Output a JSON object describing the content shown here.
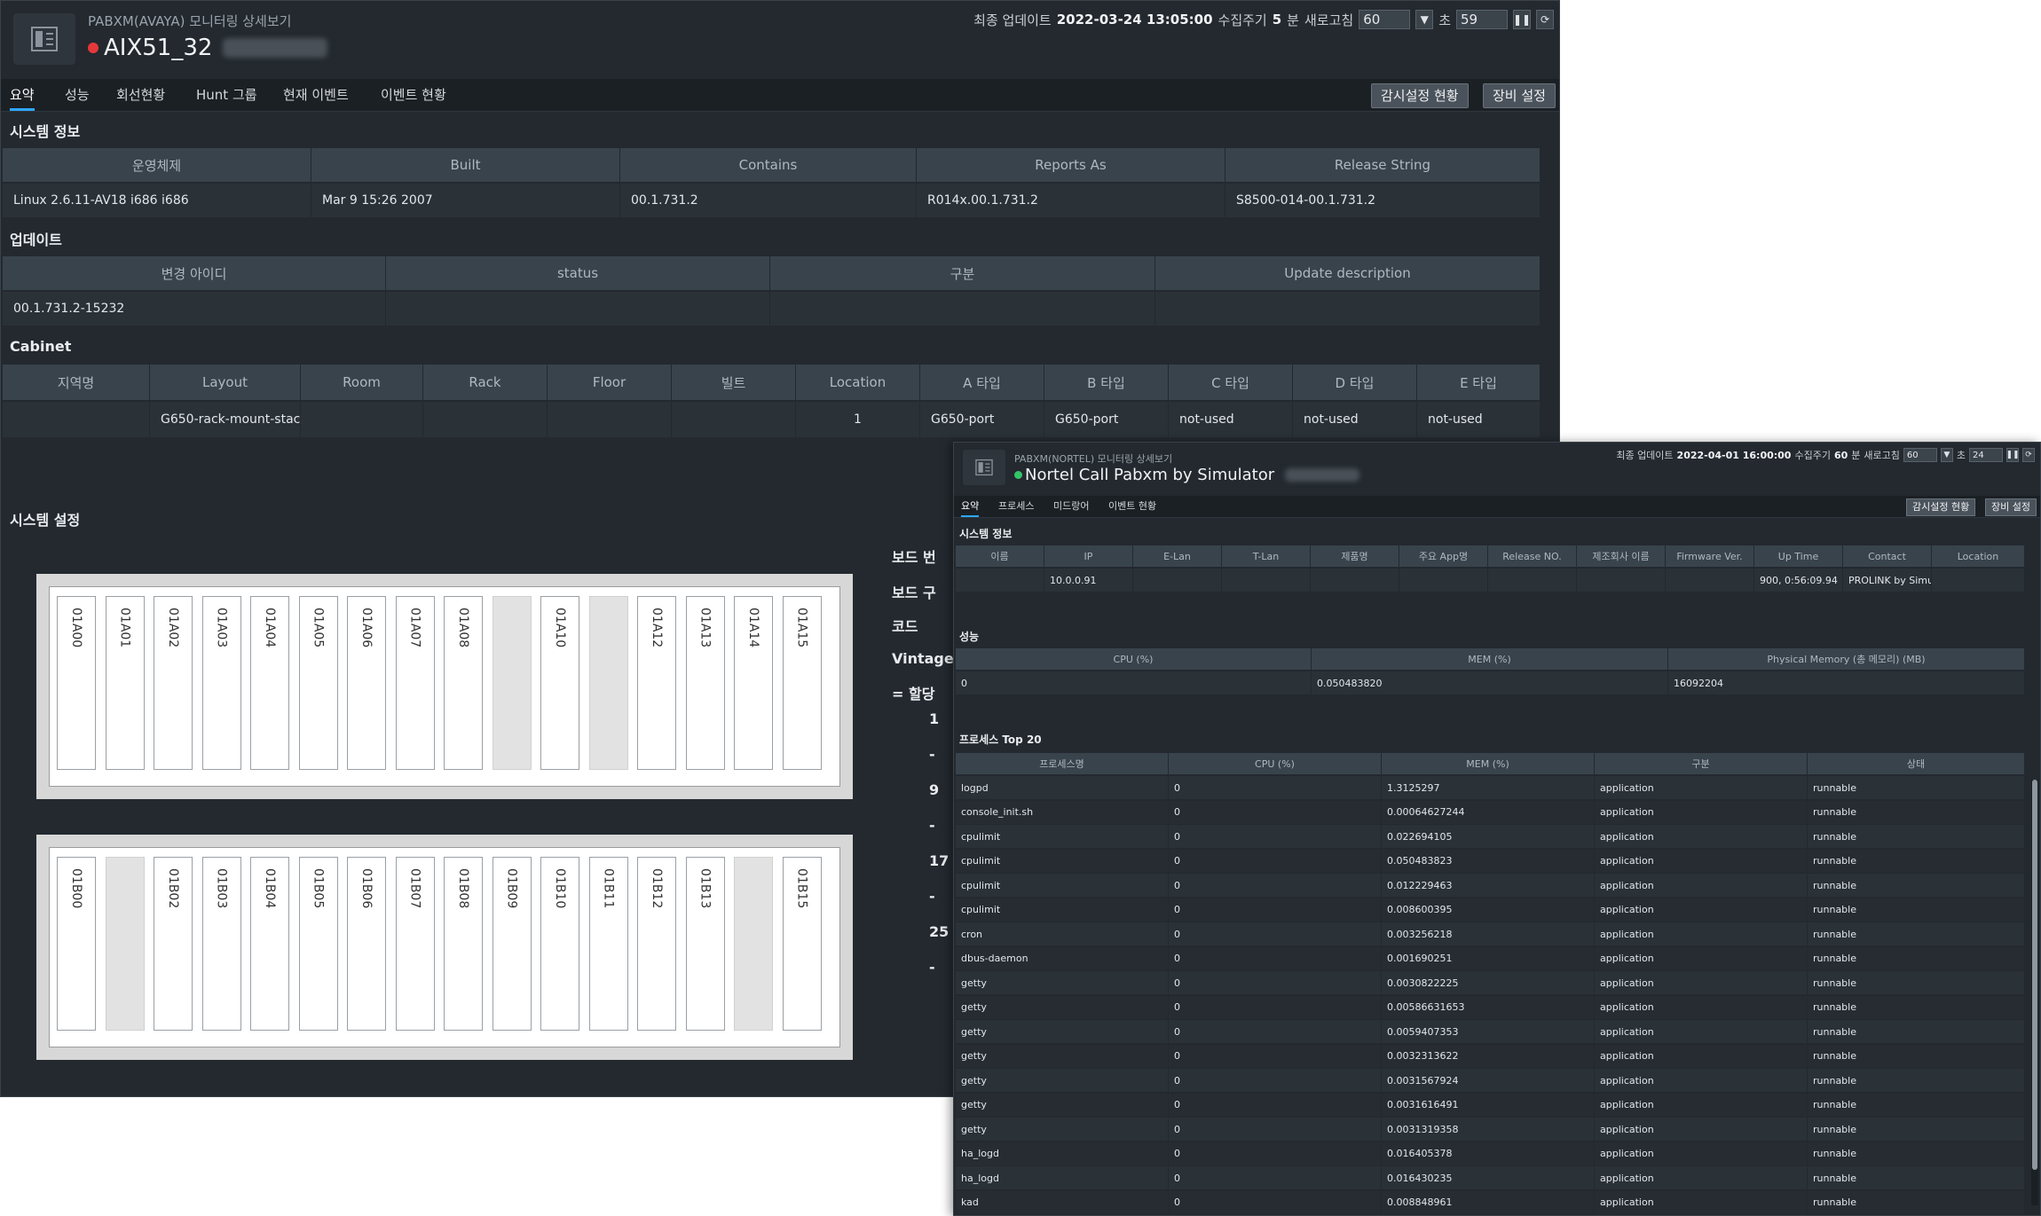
{
  "main": {
    "subtitle": "PABXM(AVAYA) 모니터링 상세보기",
    "title": "AIX51_32",
    "status_color": "#e5383b",
    "header": {
      "last_update_label": "최종 업데이트",
      "last_update_value": "2022-03-24 13:05:00",
      "period_label": "수집주기",
      "period_value": "5",
      "period_unit": "분",
      "refresh_label": "새로고침",
      "refresh_select": "60",
      "seconds_label": "초",
      "countdown": "59"
    },
    "tabs": [
      "요약",
      "성능",
      "회선현황",
      "Hunt 그룹",
      "현재 이벤트",
      "이벤트 현황"
    ],
    "buttons": {
      "monitor": "감시설정 현황",
      "device": "장비 설정"
    },
    "sysinfo": {
      "title": "시스템 정보",
      "headers": [
        "운영체제",
        "Built",
        "Contains",
        "Reports As",
        "Release String"
      ],
      "row": [
        "Linux 2.6.11-AV18 i686 i686",
        "Mar 9 15:26 2007",
        "00.1.731.2",
        "R014x.00.1.731.2",
        "S8500-014-00.1.731.2"
      ]
    },
    "update": {
      "title": "업데이트",
      "headers": [
        "변경 아이디",
        "status",
        "구분",
        "Update description"
      ],
      "row": [
        "00.1.731.2-15232",
        "",
        "",
        ""
      ]
    },
    "cabinet": {
      "title": "Cabinet",
      "headers": [
        "지역명",
        "Layout",
        "Room",
        "Rack",
        "Floor",
        "빌트",
        "Location",
        "A 타입",
        "B 타입",
        "C 타입",
        "D 타입",
        "E 타입"
      ],
      "row": [
        "",
        "G650-rack-mount-stac",
        "",
        "",
        "",
        "",
        "1",
        "G650-port",
        "G650-port",
        "not-used",
        "not-used",
        "not-used"
      ]
    },
    "syssetting": {
      "title": "시스템 설정"
    },
    "board_a": [
      "01A00",
      "01A01",
      "01A02",
      "01A03",
      "01A04",
      "01A05",
      "01A06",
      "01A07",
      "01A08",
      "",
      "01A10",
      "",
      "01A12",
      "01A13",
      "01A14",
      "01A15"
    ],
    "board_b": [
      "01B00",
      "",
      "01B02",
      "01B03",
      "01B04",
      "01B05",
      "01B06",
      "01B07",
      "01B08",
      "01B09",
      "01B10",
      "01B11",
      "01B12",
      "01B13",
      "",
      "01B15"
    ],
    "side_labels": [
      "보드 번",
      "보드 구",
      "코드",
      "Vintage",
      "= 할당 "
    ],
    "side_values": [
      "1",
      "-",
      "9",
      "-",
      "17",
      "-",
      "25",
      "-"
    ]
  },
  "second": {
    "subtitle": "PABXM(NORTEL) 모니터링 상세보기",
    "title": "Nortel Call Pabxm by Simulator",
    "status_color": "#35c46a",
    "header": {
      "last_update_label": "최종 업데이트",
      "last_update_value": "2022-04-01 16:00:00",
      "period_label": "수집주기",
      "period_value": "60",
      "period_unit": "분",
      "refresh_label": "새로고침",
      "refresh_select": "60",
      "seconds_label": "초",
      "countdown": "24"
    },
    "tabs": [
      "요약",
      "프로세스",
      "미드랑어",
      "이벤트 현황"
    ],
    "buttons": {
      "monitor": "감시설정 현황",
      "device": "장비 설정"
    },
    "sysinfo": {
      "title": "시스템 정보",
      "headers": [
        "이름",
        "IP",
        "E-Lan",
        "T-Lan",
        "제품명",
        "주요 App명",
        "Release NO.",
        "제조회사 이름",
        "Firmware Ver.",
        "Up Time",
        "Contact",
        "Location"
      ],
      "row": [
        "",
        "10.0.0.91",
        "",
        "",
        "",
        "",
        "",
        "",
        "",
        "900, 0:56:09.94",
        "PROLINK by Simula",
        ""
      ]
    },
    "perf": {
      "title": "성능",
      "headers": [
        "CPU (%)",
        "MEM (%)",
        "Physical Memory (총 메모리) (MB)"
      ],
      "row": [
        "0",
        "0.050483820",
        "16092204"
      ]
    },
    "proc": {
      "title": "프로세스 Top 20",
      "headers": [
        "프로세스명",
        "CPU (%)",
        "MEM (%)",
        "구분",
        "상태"
      ],
      "rows": [
        [
          "logpd",
          "0",
          "1.3125297",
          "application",
          "runnable"
        ],
        [
          "console_init.sh",
          "0",
          "0.00064627244",
          "application",
          "runnable"
        ],
        [
          "cpulimit",
          "0",
          "0.022694105",
          "application",
          "runnable"
        ],
        [
          "cpulimit",
          "0",
          "0.050483823",
          "application",
          "runnable"
        ],
        [
          "cpulimit",
          "0",
          "0.012229463",
          "application",
          "runnable"
        ],
        [
          "cpulimit",
          "0",
          "0.008600395",
          "application",
          "runnable"
        ],
        [
          "cron",
          "0",
          "0.003256218",
          "application",
          "runnable"
        ],
        [
          "dbus-daemon",
          "0",
          "0.001690251",
          "application",
          "runnable"
        ],
        [
          "getty",
          "0",
          "0.0030822225",
          "application",
          "runnable"
        ],
        [
          "getty",
          "0",
          "0.00586631653",
          "application",
          "runnable"
        ],
        [
          "getty",
          "0",
          "0.0059407353",
          "application",
          "runnable"
        ],
        [
          "getty",
          "0",
          "0.0032313622",
          "application",
          "runnable"
        ],
        [
          "getty",
          "0",
          "0.0031567924",
          "application",
          "runnable"
        ],
        [
          "getty",
          "0",
          "0.0031616491",
          "application",
          "runnable"
        ],
        [
          "getty",
          "0",
          "0.0031319358",
          "application",
          "runnable"
        ],
        [
          "ha_logd",
          "0",
          "0.016405378",
          "application",
          "runnable"
        ],
        [
          "ha_logd",
          "0",
          "0.016430235",
          "application",
          "runnable"
        ],
        [
          "kad",
          "0",
          "0.008848961",
          "application",
          "runnable"
        ]
      ]
    }
  }
}
